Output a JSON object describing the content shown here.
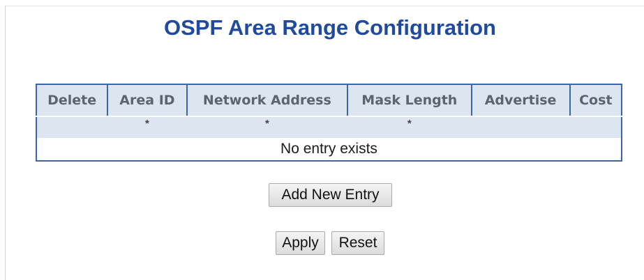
{
  "page": {
    "title": "OSPF Area Range Configuration"
  },
  "table": {
    "headers": [
      "Delete",
      "Area ID",
      "Network Address",
      "Mask Length",
      "Advertise",
      "Cost"
    ],
    "filter_row": [
      "",
      "*",
      "*",
      "*",
      "",
      ""
    ],
    "empty_message": "No entry exists"
  },
  "buttons": {
    "add_new_entry": "Add New Entry",
    "apply": "Apply",
    "reset": "Reset"
  },
  "colors": {
    "title": "#1f4aa0",
    "table_border": "#3a66a7",
    "header_bg": "#dde6f0",
    "header_text": "#5b6571"
  }
}
